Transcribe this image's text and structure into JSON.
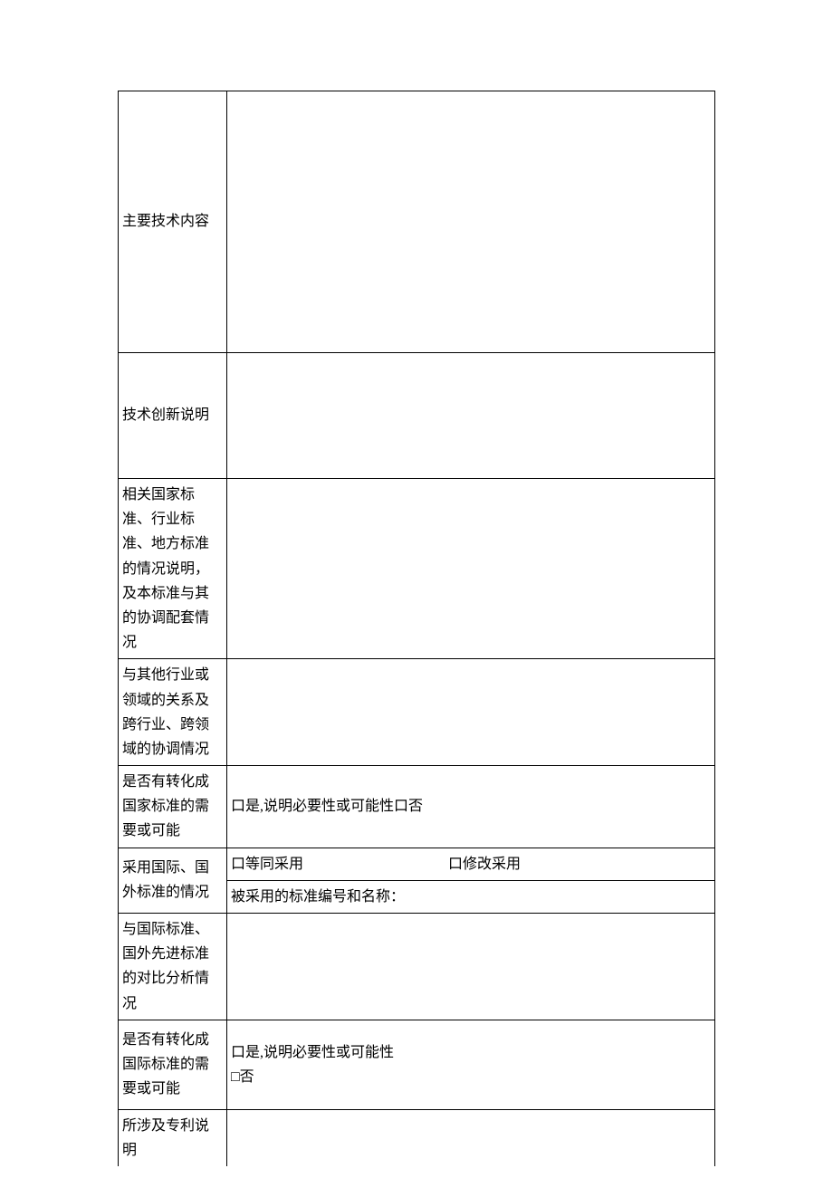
{
  "rows": {
    "r1_label": "主要技术内容",
    "r2_label": "技术创新说明",
    "r3_label": "相关国家标准、行业标准、地方标准的情况说明，及本标准与其的协调配套情况",
    "r4_label": "与其他行业或领域的关系及跨行业、跨领域的协调情况",
    "r5_label": "是否有转化成国家标准的需要或可能",
    "r5_content": "口是,说明必要性或可能性口否",
    "r6_label": "采用国际、国外标准的情况",
    "r6_line1_a": "口等同采用",
    "r6_line1_b": "口修改采用",
    "r6_line2": "被采用的标准编号和名称：",
    "r7_label": "与国际标准、国外先进标准的对比分析情况",
    "r8_label": "是否有转化成国际标准的需要或可能",
    "r8_line1": "口是,说明必要性或可能性",
    "r8_line2": "□否",
    "r9_label": "所涉及专利说明"
  }
}
